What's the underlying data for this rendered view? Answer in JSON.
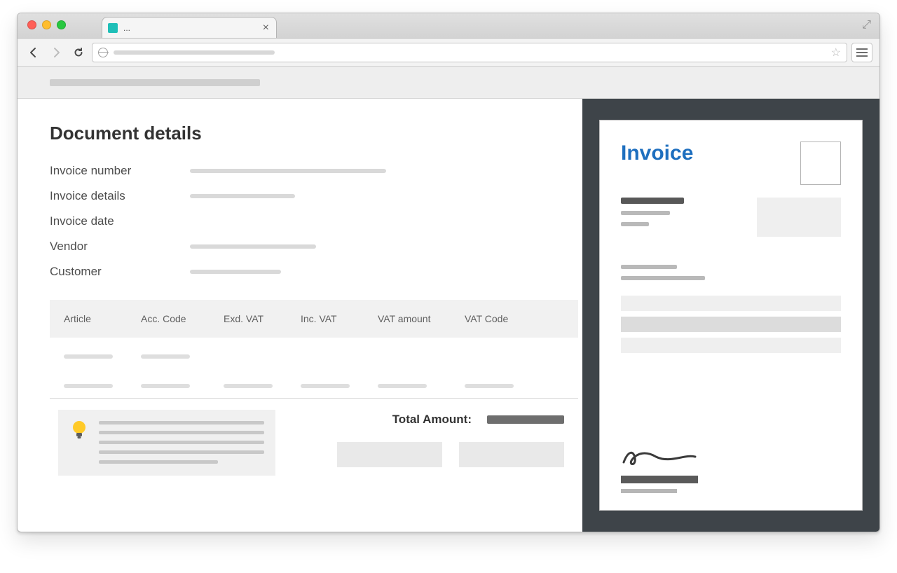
{
  "browser": {
    "tab_title": "...",
    "close_glyph": "×",
    "star_glyph": "☆",
    "expand_glyph": "⤢"
  },
  "page": {
    "title": "Document details",
    "fields": [
      {
        "label": "Invoice number"
      },
      {
        "label": "Invoice details"
      },
      {
        "label": "Invoice date"
      },
      {
        "label": "Vendor"
      },
      {
        "label": "Customer"
      }
    ],
    "table": {
      "columns": [
        "Article",
        "Acc. Code",
        "Exd. VAT",
        "Inc. VAT",
        "VAT amount",
        "VAT Code"
      ]
    },
    "total_label": "Total Amount:"
  },
  "preview": {
    "heading": "Invoice"
  }
}
